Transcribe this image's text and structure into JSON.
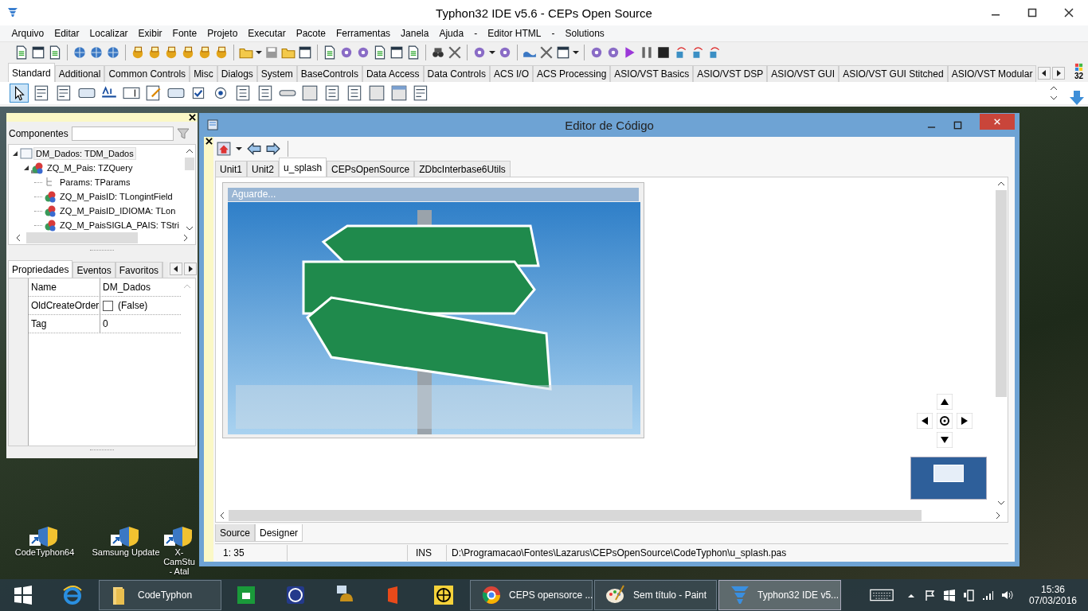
{
  "ide": {
    "title": "Typhon32 IDE v5.6 - CEPs Open Source",
    "menu": [
      "Arquivo",
      "Editar",
      "Localizar",
      "Exibir",
      "Fonte",
      "Projeto",
      "Executar",
      "Pacote",
      "Ferramentas",
      "Janela",
      "Ajuda",
      "-",
      "Editor HTML",
      "-",
      "Solutions"
    ],
    "palette": {
      "badge": "32",
      "tabs": [
        {
          "label": "Standard",
          "selected": true
        },
        {
          "label": "Additional",
          "selected": false
        },
        {
          "label": "Common Controls",
          "selected": false
        },
        {
          "label": "Misc",
          "selected": false
        },
        {
          "label": "Dialogs",
          "selected": false
        },
        {
          "label": "System",
          "selected": false
        },
        {
          "label": "BaseControls",
          "selected": false
        },
        {
          "label": "Data Access",
          "selected": false
        },
        {
          "label": "Data Controls",
          "selected": false
        },
        {
          "label": "ACS I/O",
          "selected": false
        },
        {
          "label": "ACS Processing",
          "selected": false
        },
        {
          "label": "ASIO/VST Basics",
          "selected": false
        },
        {
          "label": "ASIO/VST DSP",
          "selected": false
        },
        {
          "label": "ASIO/VST GUI",
          "selected": false
        },
        {
          "label": "ASIO/VST GUI Stitched",
          "selected": false
        },
        {
          "label": "ASIO/VST Modular",
          "selected": false
        }
      ]
    }
  },
  "inspector": {
    "search_label": "Componentes",
    "tree": [
      {
        "label": "DM_Dados: TDM_Dados",
        "kind": "form",
        "selected": true,
        "expanded": true,
        "children": [
          {
            "label": "ZQ_M_Pais: TZQuery",
            "kind": "query",
            "selected": false,
            "expanded": true,
            "children": [
              {
                "label": "Params: TParams",
                "kind": "params",
                "selected": false
              },
              {
                "label": "ZQ_M_PaisID: TLongintField",
                "kind": "field",
                "selected": false
              },
              {
                "label": "ZQ_M_PaisID_IDIOMA: TLon",
                "kind": "field",
                "selected": false
              },
              {
                "label": "ZQ_M_PaisSIGLA_PAIS: TStri",
                "kind": "field",
                "selected": false
              }
            ]
          }
        ]
      }
    ],
    "tabs": [
      {
        "label": "Propriedades",
        "selected": true
      },
      {
        "label": "Eventos",
        "selected": false
      },
      {
        "label": "Favoritos",
        "selected": false
      }
    ],
    "properties": [
      {
        "name": "Name",
        "kind": "text",
        "value": "DM_Dados"
      },
      {
        "name": "OldCreateOrder",
        "kind": "checkbox",
        "checked": false,
        "value": "(False)"
      },
      {
        "name": "Tag",
        "kind": "text",
        "value": "0"
      }
    ]
  },
  "desktop_icons": [
    {
      "label": "CodeTyphon64"
    },
    {
      "label": "Samsung Update"
    },
    {
      "label": "X-CamStu\n- Atal"
    }
  ],
  "editor": {
    "title": "Editor de Código",
    "tabs": [
      {
        "label": "Unit1",
        "selected": false
      },
      {
        "label": "Unit2",
        "selected": false
      },
      {
        "label": "u_splash",
        "selected": true
      },
      {
        "label": "CEPsOpenSource",
        "selected": false
      },
      {
        "label": "ZDbcInterbase6Utils",
        "selected": false
      }
    ],
    "form_caption": "Aguarde...",
    "view_tabs": [
      {
        "label": "Source",
        "selected": false
      },
      {
        "label": "Designer",
        "selected": true
      }
    ],
    "status": {
      "position": "1: 35",
      "mode": "INS",
      "file": "D:\\Programacao\\Fontes\\Lazarus\\CEPsOpenSource\\CodeTyphon\\u_splash.pas"
    }
  },
  "taskbar": {
    "items": [
      {
        "kind": "start",
        "selected": false
      },
      {
        "kind": "browser",
        "selected": false
      },
      {
        "kind": "folder",
        "label": "CodeTyphon",
        "selected": false
      },
      {
        "kind": "store",
        "selected": false
      },
      {
        "kind": "help",
        "selected": false
      },
      {
        "kind": "bell",
        "selected": false
      },
      {
        "kind": "office",
        "selected": false
      },
      {
        "kind": "globe",
        "selected": false
      },
      {
        "kind": "chrome",
        "label": "CEPS opensorce ...",
        "selected": false
      },
      {
        "kind": "paint",
        "label": "Sem título - Paint",
        "selected": false
      },
      {
        "kind": "typhon",
        "label": "Typhon32 IDE v5...",
        "selected": true
      }
    ],
    "clock": {
      "time": "15:36",
      "date": "07/03/2016"
    }
  }
}
